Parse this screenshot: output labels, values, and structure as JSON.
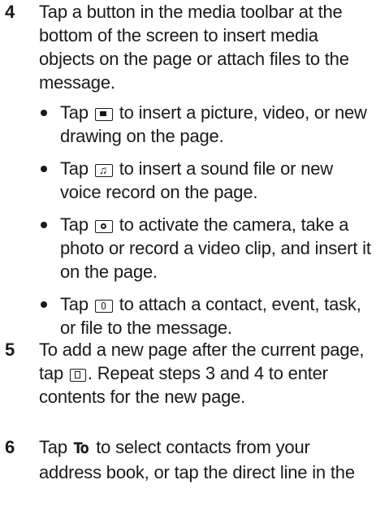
{
  "steps": [
    {
      "number": "4",
      "text": "Tap a button in the media toolbar at the bottom of the screen to insert media objects on the page or attach files to the message.",
      "bullets": [
        {
          "pre": "Tap",
          "icon": "picture-icon",
          "post": "to insert a picture, video, or new drawing on the page."
        },
        {
          "pre": "Tap",
          "icon": "sound-icon",
          "post": "to insert a sound file or new voice record on the page."
        },
        {
          "pre": "Tap",
          "icon": "camera-icon",
          "post": "to activate the camera, take a photo or record a video clip, and insert it on the page."
        },
        {
          "pre": "Tap",
          "icon": "attach-icon",
          "post": "to attach a contact, event, task, or file to the message."
        }
      ]
    },
    {
      "number": "5",
      "pre": "To add a new page after the current page, tap",
      "icon": "new-page-icon",
      "post": ". Repeat steps 3 and 4 to enter contents for the new page."
    },
    {
      "number": "6",
      "pre": "Tap",
      "button_label": "To",
      "post": "to select contacts from your address book, or tap the direct line in the"
    }
  ]
}
